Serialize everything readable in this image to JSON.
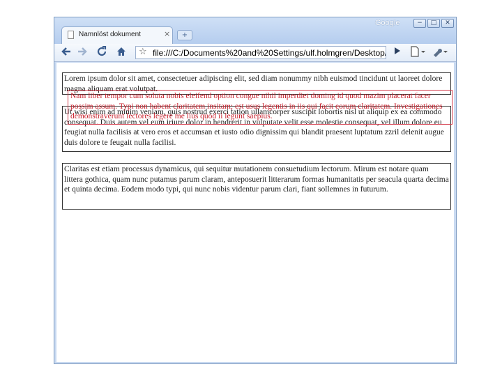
{
  "window": {
    "brand": "Google",
    "controls": {
      "minimize": "−",
      "maximize": "□",
      "close": "✕"
    }
  },
  "tab": {
    "title": "Namnlöst dokument",
    "close": "×",
    "new_tab": "+"
  },
  "toolbar": {
    "back_icon": "arrow-left-icon",
    "forward_icon": "arrow-right-icon",
    "reload_icon": "reload-icon",
    "home_icon": "home-icon",
    "url": "file:///C:/Documents%20and%20Settings/ulf.holmgren/Desktop/",
    "go_icon": "play-icon",
    "page_menu_icon": "page-icon",
    "tools_menu_icon": "wrench-icon"
  },
  "content": {
    "paragraph1": "Lorem ipsum dolor sit amet, consectetuer adipiscing elit, sed diam nonummy nibh euismod tincidunt ut laoreet dolore magna aliquam erat volutpat.",
    "paragraph2": "Ut wisi enim ad minim veniam, quis nostrud exerci tation ullamcorper suscipit lobortis nisl ut aliquip ex ea commodo consequat. Duis autem vel eum iriure dolor in hendrerit in vulputate velit esse molestie consequat, vel illum dolore eu feugiat nulla facilisis at vero eros et accumsan et iusto odio dignissim qui blandit praesent luptatum zzril delenit augue duis dolore te feugait nulla facilisi.",
    "overlay": "Nam liber tempor cum soluta nobis eleifend option congue nihil imperdiet doming id quod mazim placerat facer possim assum. Typi non habent claritatem insitam; est usus legentis in iis qui facit eorum claritatem. Investigationes demonstraverunt lectores legere me lius quod ii legunt saepius.",
    "paragraph3": "Claritas est etiam processus dynamicus, qui sequitur mutationem consuetudium lectorum. Mirum est notare quam littera gothica, quam nunc putamus parum claram, anteposuerit litterarum formas humanitatis per seacula quarta decima et quinta decima. Eodem modo typi, qui nunc nobis videntur parum clari, fiant sollemnes in futurum."
  },
  "colors": {
    "overlay_text": "#c8202c",
    "overlay_border": "#d43a4a",
    "frame": "#c9daf1"
  }
}
